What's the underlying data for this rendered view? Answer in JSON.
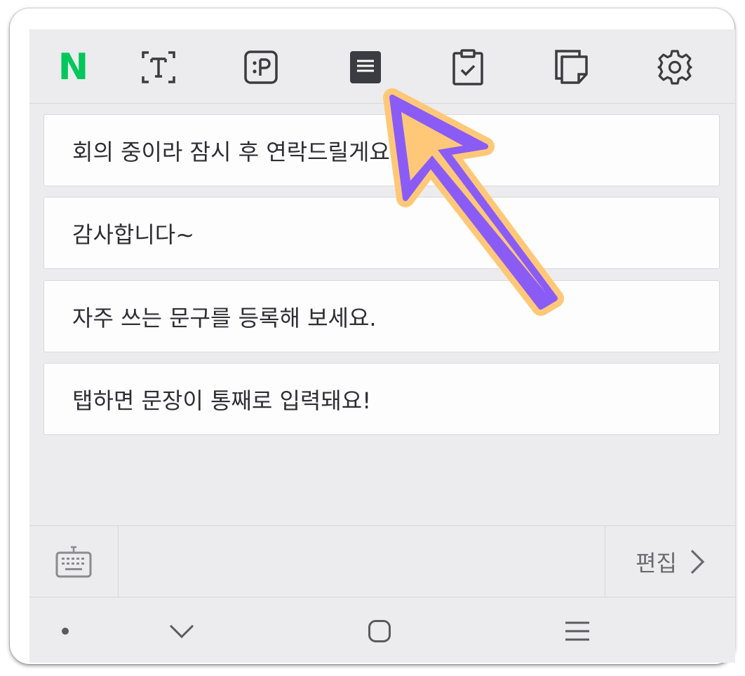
{
  "toolbar": {
    "logo_text": "N",
    "logo_color": "#03c75a",
    "icons": [
      "naver-logo",
      "text-icon",
      "emoticon-icon",
      "phrases-icon",
      "clipboard-icon",
      "memo-icon",
      "settings-icon"
    ],
    "active_tab": "phrases-icon"
  },
  "phrases": [
    "회의 중이라 잠시 후 연락드릴게요.",
    "감사합니다~",
    "자주 쓰는 문구를 등록해 보세요.",
    "탭하면 문장이 통째로 입력돼요!"
  ],
  "bottom_bar": {
    "keyboard_icon": "keyboard-icon",
    "edit_label": "편집"
  },
  "system_nav": {
    "icons": [
      "dot-icon",
      "chevron-down-icon",
      "home-icon",
      "menu-icon"
    ]
  },
  "annotation": {
    "fill_color": "#8a5cf5",
    "outline_color": "#ffc878"
  }
}
